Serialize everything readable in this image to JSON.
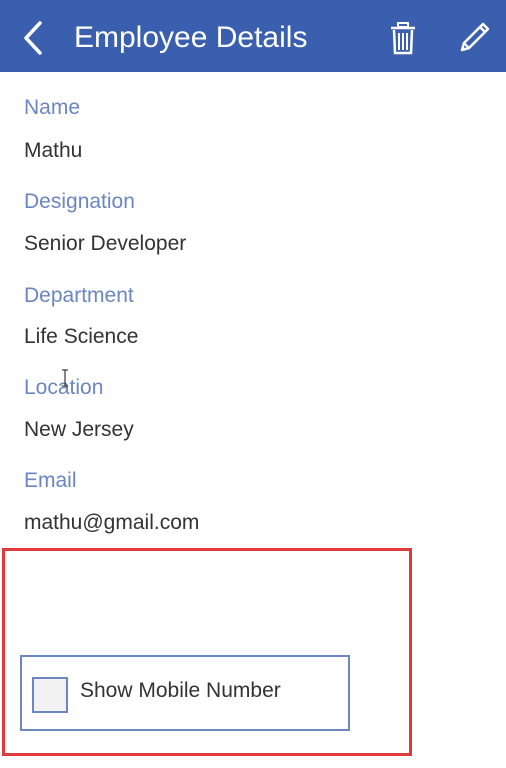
{
  "header": {
    "title": "Employee Details",
    "back_icon": "chevron-left",
    "delete_icon": "trash",
    "edit_icon": "pencil",
    "background": "#3a5fae"
  },
  "fields": [
    {
      "label": "Name",
      "value": "Mathu"
    },
    {
      "label": "Designation",
      "value": "Senior Developer"
    },
    {
      "label": "Department",
      "value": "Life Science"
    },
    {
      "label": "Location",
      "value": "New Jersey"
    },
    {
      "label": "Email",
      "value": "mathu@gmail.com"
    }
  ],
  "toggle": {
    "label": "Show Mobile Number",
    "checked": false
  },
  "colors": {
    "label": "#6b86c0",
    "value": "#333333",
    "highlight": "#e03a3e"
  }
}
